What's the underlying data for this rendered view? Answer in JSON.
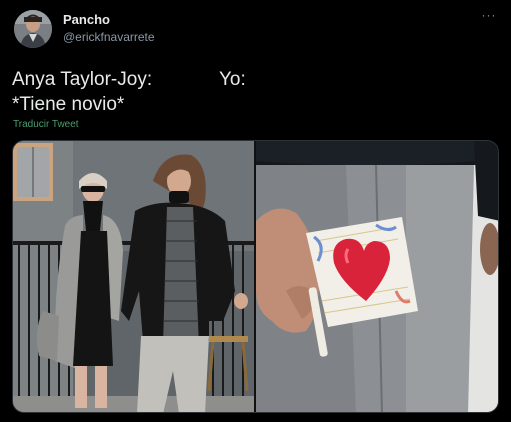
{
  "author": {
    "display_name": "Pancho",
    "handle": "@erickfnavarrete",
    "avatar_icon": "avatar-photo-icon"
  },
  "tweet": {
    "line1_left": "Anya Taylor-Joy:",
    "line1_right": "Yo:",
    "line2": "*Tiene novio*",
    "translate_label": "Traducir Tweet",
    "more_label": "···"
  },
  "colors": {
    "background": "#000000",
    "text": "#e7e9ea",
    "secondary": "#8b98a5",
    "translate": "#4a9d6f"
  },
  "media": {
    "left_photo_icon": "couple-walking-photo-icon",
    "right_photo_icon": "heart-lollipop-photo-icon"
  }
}
